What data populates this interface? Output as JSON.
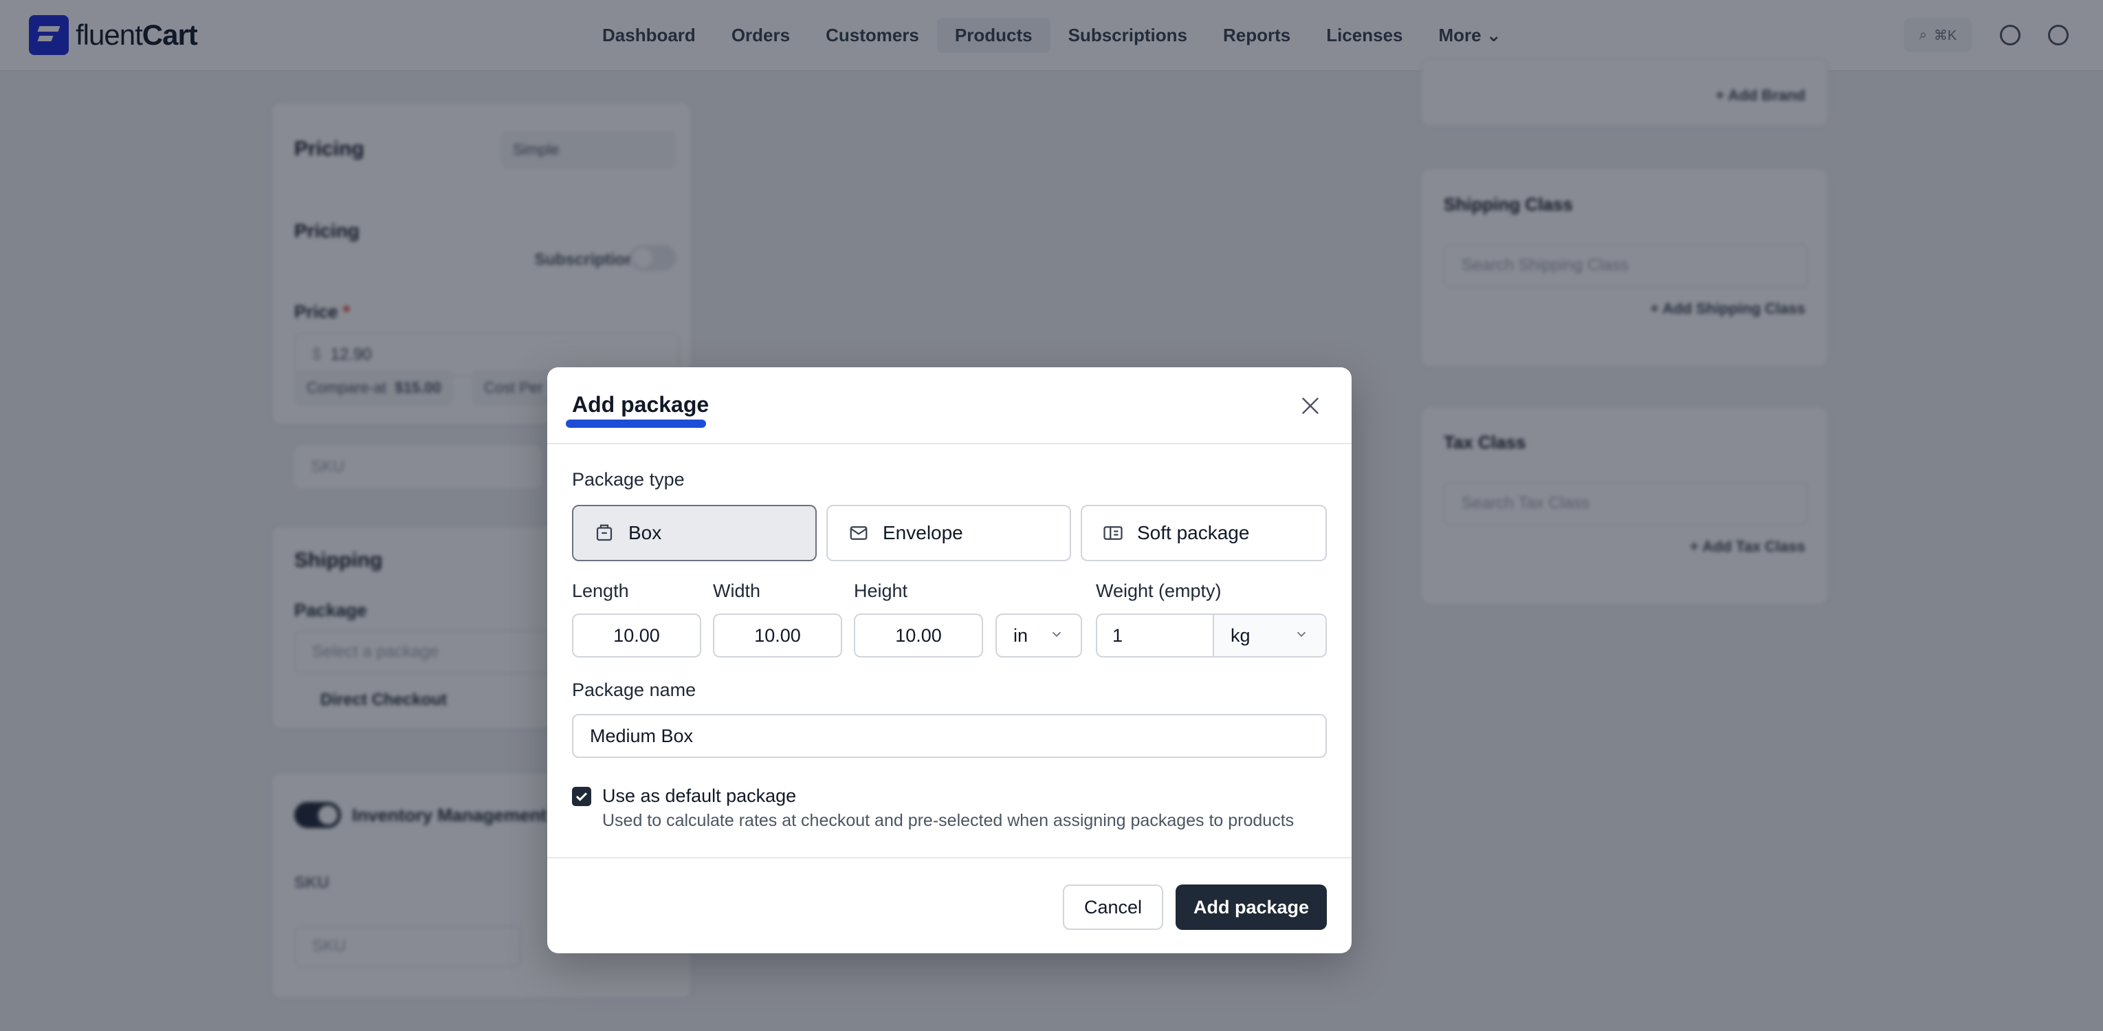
{
  "app": {
    "logo_text_light": "fluent",
    "logo_text_bold": "Cart"
  },
  "nav": {
    "items": [
      "Dashboard",
      "Orders",
      "Customers",
      "Products",
      "Subscriptions",
      "Reports",
      "Licenses",
      "More"
    ],
    "active": "Products",
    "search_shortcut": "⌘K"
  },
  "background": {
    "pricing_section_title": "Pricing",
    "pricing_type": "Simple",
    "pricing_subtitle": "Pricing",
    "subscription_label": "Subscription",
    "price_label": "Price",
    "price_required": "*",
    "currency": "$",
    "price_value": "12.90",
    "compare_at_label": "Compare-at",
    "compare_at_value": "$15.00",
    "cost_label": "Cost Per",
    "sku_placeholder": "SKU",
    "shipping_title": "Shipping",
    "package_label": "Package",
    "package_placeholder": "Select a package",
    "direct_checkout": "Direct Checkout",
    "inventory_label": "Inventory Management",
    "sku_col": "SKU",
    "sku_cell_placeholder": "SKU",
    "add_brand": "+ Add Brand",
    "shipping_class_title": "Shipping Class",
    "shipping_class_placeholder": "Search Shipping Class",
    "add_shipping_class": "+ Add Shipping Class",
    "tax_class_title": "Tax Class",
    "tax_class_placeholder": "Search Tax Class",
    "add_tax_class": "+ Add Tax Class"
  },
  "modal": {
    "title": "Add package",
    "package_type_label": "Package type",
    "types": [
      {
        "label": "Box",
        "icon": "box-icon",
        "selected": true
      },
      {
        "label": "Envelope",
        "icon": "envelope-icon",
        "selected": false
      },
      {
        "label": "Soft package",
        "icon": "soft-package-icon",
        "selected": false
      }
    ],
    "length_label": "Length",
    "width_label": "Width",
    "height_label": "Height",
    "weight_label": "Weight (empty)",
    "length_value": "10.00",
    "width_value": "10.00",
    "height_value": "10.00",
    "dimension_unit": "in",
    "weight_value": "1",
    "weight_unit": "kg",
    "name_label": "Package name",
    "name_value": "Medium Box",
    "default_checked": true,
    "default_label": "Use as default package",
    "default_help": "Used to calculate rates at checkout and pre-selected when assigning packages to products",
    "cancel_label": "Cancel",
    "submit_label": "Add package",
    "accent_color": "#1d4ed8"
  }
}
